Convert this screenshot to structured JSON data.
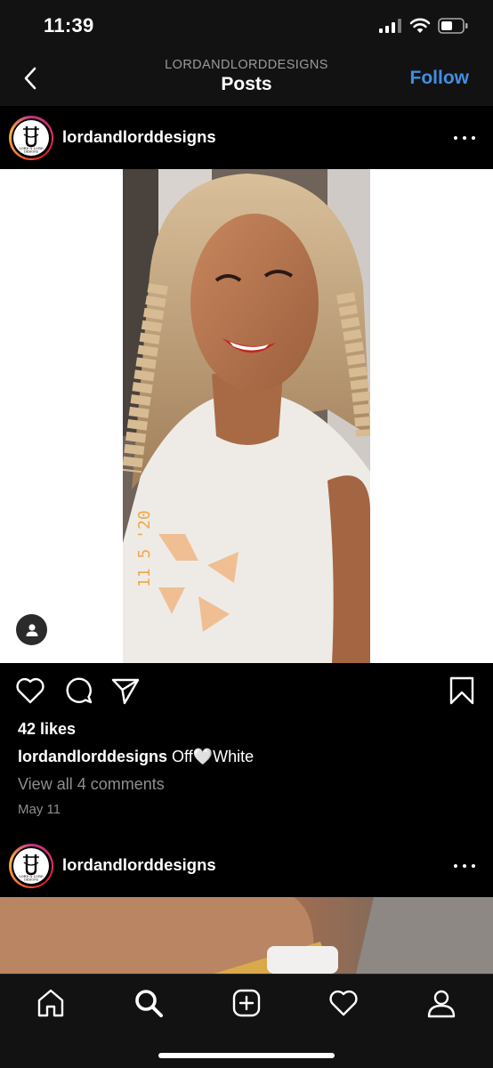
{
  "status_bar": {
    "time": "11:39",
    "icons": [
      "signal-icon",
      "wifi-icon",
      "battery-icon"
    ]
  },
  "header": {
    "account": "LORDANDLORDDESIGNS",
    "title": "Posts",
    "follow_label": "Follow",
    "back_icon": "chevron-left-icon"
  },
  "posts": [
    {
      "username": "lordandlorddesigns",
      "avatar_text_line1": "LORD & LORD",
      "avatar_text_line2": "DESIGNS",
      "photo_stamp": "11 5 '20",
      "likes": "42 likes",
      "caption_user": "lordandlorddesigns",
      "caption_text_before": "Off",
      "caption_emoji": "🤍",
      "caption_text_after": "White",
      "view_comments": "View all 4 comments",
      "date": "May 11"
    },
    {
      "username": "lordandlorddesigns"
    }
  ],
  "actions": [
    "heart-icon",
    "comment-icon",
    "share-icon",
    "bookmark-icon"
  ],
  "tab_bar": [
    "home-icon",
    "search-icon",
    "add-icon",
    "activity-icon",
    "profile-icon"
  ],
  "colors": {
    "accent_blue": "#3f8fe3",
    "background": "#000000",
    "bar_background": "#121212",
    "muted_text": "#8e8e8e"
  }
}
